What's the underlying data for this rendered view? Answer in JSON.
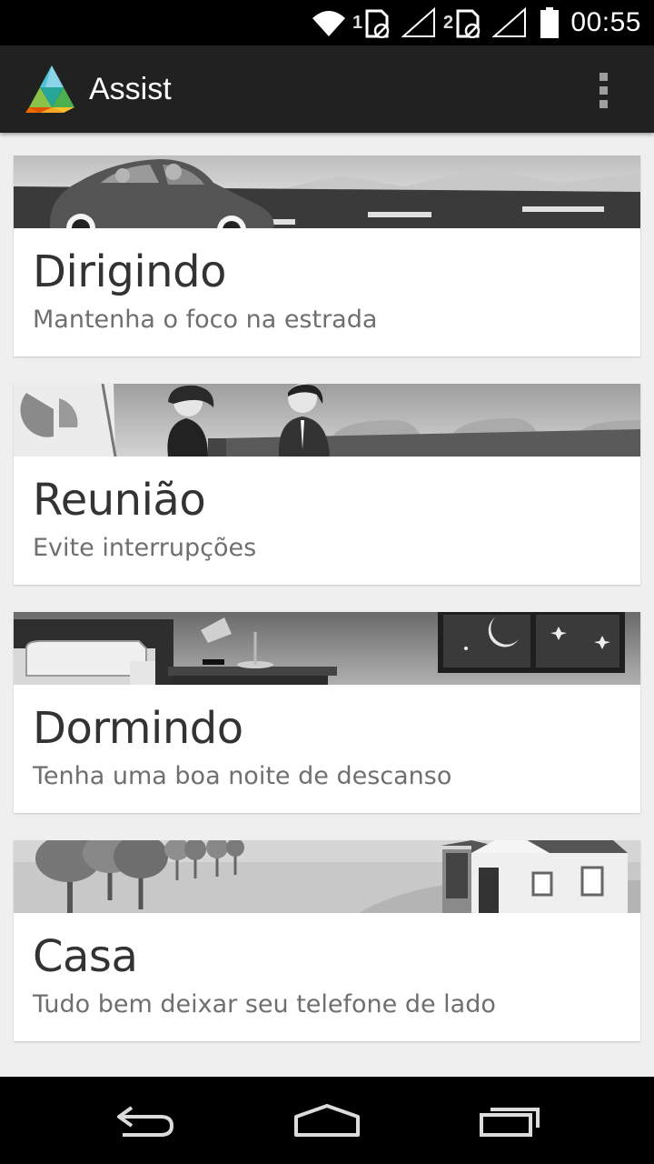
{
  "status_bar": {
    "sim1_label": "1",
    "sim2_label": "2",
    "time": "00:55",
    "icons": [
      "wifi-icon",
      "sim-card-icon",
      "signal-icon",
      "sim-card-icon",
      "signal-icon",
      "battery-icon"
    ]
  },
  "action_bar": {
    "title": "Assist",
    "logo_icon": "assist-logo-icon",
    "overflow_icon": "overflow-menu-icon"
  },
  "cards": [
    {
      "title": "Dirigindo",
      "subtitle": "Mantenha o foco na estrada",
      "banner": "driving-illustration"
    },
    {
      "title": "Reunião",
      "subtitle": "Evite interrupções",
      "banner": "meeting-illustration"
    },
    {
      "title": "Dormindo",
      "subtitle": "Tenha uma boa noite de descanso",
      "banner": "sleeping-illustration"
    },
    {
      "title": "Casa",
      "subtitle": "Tudo bem deixar seu telefone de lado",
      "banner": "home-illustration"
    }
  ],
  "nav_bar": {
    "icons": [
      "back-icon",
      "home-icon",
      "recent-apps-icon"
    ]
  },
  "colors": {
    "status_bar": "#000000",
    "action_bar": "#212121",
    "background": "#efefef",
    "card": "#ffffff",
    "title_text": "#333333",
    "subtitle_text": "#6f6f6f"
  }
}
